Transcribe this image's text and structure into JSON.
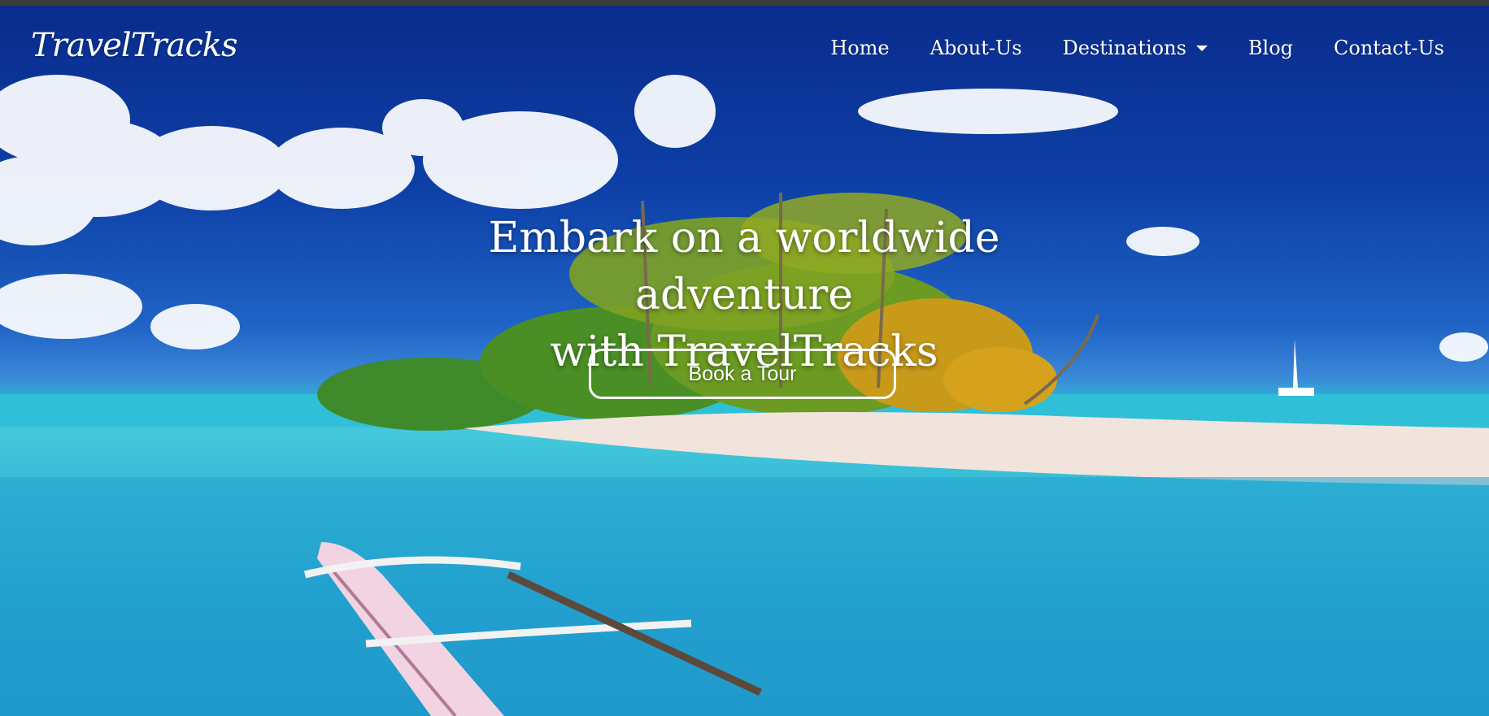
{
  "brand": {
    "name": "TravelTracks"
  },
  "nav": {
    "items": [
      {
        "label": "Home"
      },
      {
        "label": "About-Us"
      },
      {
        "label": "Destinations",
        "has_dropdown": true
      },
      {
        "label": "Blog"
      },
      {
        "label": "Contact-Us"
      }
    ]
  },
  "hero": {
    "headline_line1": "Embark on a worldwide adventure",
    "headline_line2": "with TravelTracks",
    "cta_label": "Book a Tour",
    "background": "tropical-island-beach-photo"
  },
  "colors": {
    "sky_top": "#0a2c8c",
    "sea": "#44c9dc",
    "text": "#ffffff"
  }
}
